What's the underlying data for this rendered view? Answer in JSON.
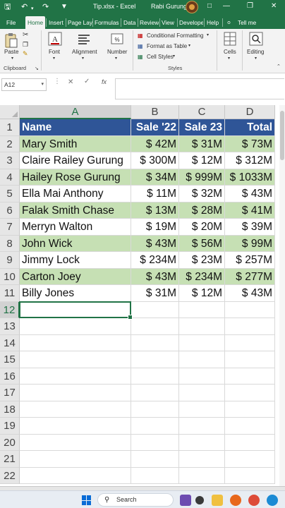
{
  "titlebar": {
    "save_icon": "save-icon",
    "undo_icon": "undo-icon",
    "filename": "Tip.xlsx",
    "separator": "-",
    "app": "Excel",
    "user_name": "Rabi Gurung"
  },
  "tabs": [
    "File",
    "Home",
    "Insert",
    "Page Layo",
    "Formulas",
    "Data",
    "Review",
    "View",
    "Develope",
    "Help"
  ],
  "tell_me": "Tell me",
  "ribbon": {
    "paste": "Paste",
    "font": "Font",
    "alignment": "Alignment",
    "number": "Number",
    "conditional_formatting": "Conditional Formatting",
    "format_as_table": "Format as Table",
    "cell_styles": "Cell Styles",
    "cells": "Cells",
    "editing": "Editing",
    "group_clipboard": "Clipboard",
    "group_styles": "Styles"
  },
  "formula_bar": {
    "name_box": "A12",
    "fx": "fx",
    "value": ""
  },
  "columns": [
    "A",
    "B",
    "C",
    "D"
  ],
  "header_row": [
    "Name",
    "Sale '22",
    "Sale 23",
    "Total"
  ],
  "rows": [
    [
      "Mary Smith",
      "$ 42M",
      "$ 31M",
      "$ 73M"
    ],
    [
      "Claire Railey Gurung",
      "$ 300M",
      "$ 12M",
      "$ 312M"
    ],
    [
      "Hailey Rose Gurung",
      "$ 34M",
      "$ 999M",
      "$ 1033M"
    ],
    [
      "Ella Mai Anthony",
      "$ 11M",
      "$ 32M",
      "$ 43M"
    ],
    [
      "Falak Smith Chase",
      "$ 13M",
      "$ 28M",
      "$ 41M"
    ],
    [
      "Merryn Walton",
      "$ 19M",
      "$ 20M",
      "$ 39M"
    ],
    [
      "John Wick",
      "$ 43M",
      "$ 56M",
      "$ 99M"
    ],
    [
      "Jimmy Lock",
      "$ 234M",
      "$ 23M",
      "$ 257M"
    ],
    [
      "Carton Joey",
      "$ 43M",
      "$ 234M",
      "$ 277M"
    ],
    [
      "Billy Jones",
      "$ 31M",
      "$ 12M",
      "$ 43M"
    ]
  ],
  "row_numbers": [
    "1",
    "2",
    "3",
    "4",
    "5",
    "6",
    "7",
    "8",
    "9",
    "10",
    "11",
    "12",
    "13",
    "14",
    "15",
    "16",
    "17",
    "18",
    "19",
    "20",
    "21",
    "22"
  ],
  "selected_cell": "A12",
  "taskbar": {
    "search_placeholder": "Search"
  },
  "colors": {
    "excel_green": "#217346",
    "header_fill": "#2f5597",
    "band_fill": "#c6e0b4"
  }
}
